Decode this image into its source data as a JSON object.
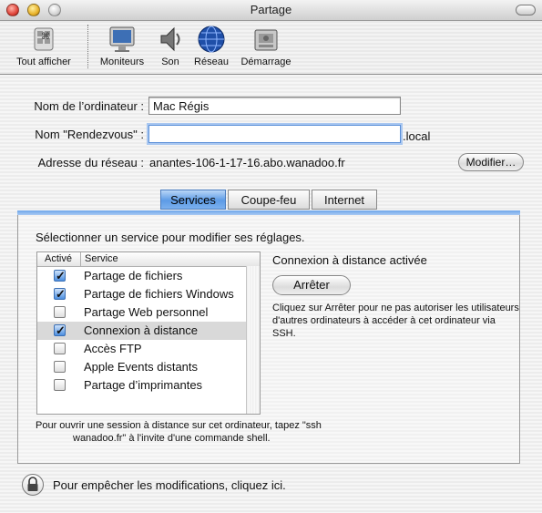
{
  "window": {
    "title": "Partage"
  },
  "toolbar": {
    "items": [
      {
        "label": "Tout afficher",
        "icon": "show-all-icon"
      },
      {
        "label": "Moniteurs",
        "icon": "monitor-icon"
      },
      {
        "label": "Son",
        "icon": "speaker-icon"
      },
      {
        "label": "Réseau",
        "icon": "network-globe-icon"
      },
      {
        "label": "Démarrage",
        "icon": "startup-disk-icon"
      }
    ]
  },
  "form": {
    "computer_name_label": "Nom de l’ordinateur :",
    "computer_name_value": "Mac Régis",
    "rendezvous_label": "Nom \"Rendezvous\" :",
    "rendezvous_value": "",
    "rendezvous_suffix": ".local",
    "address_label": "Adresse du réseau :",
    "address_value": "anantes-106-1-17-16.abo.wanadoo.fr",
    "modify_button": "Modifier…"
  },
  "tabs": [
    {
      "label": "Services",
      "active": true
    },
    {
      "label": "Coupe-feu",
      "active": false
    },
    {
      "label": "Internet",
      "active": false
    }
  ],
  "services": {
    "instruction": "Sélectionner un service pour modifier ses réglages.",
    "columns": {
      "active": "Activé",
      "service": "Service"
    },
    "rows": [
      {
        "name": "Partage de fichiers",
        "checked": true
      },
      {
        "name": "Partage de fichiers Windows",
        "checked": true
      },
      {
        "name": "Partage Web personnel",
        "checked": false
      },
      {
        "name": "Connexion à distance",
        "checked": true,
        "selected": true
      },
      {
        "name": "Accès FTP",
        "checked": false
      },
      {
        "name": "Apple Events distants",
        "checked": false
      },
      {
        "name": "Partage d’imprimantes",
        "checked": false
      }
    ],
    "status": "Connexion à distance activée",
    "stop_button": "Arrêter",
    "description": "Cliquez sur Arrêter pour ne pas autoriser les utilisateurs d'autres ordinateurs à accéder à cet ordinateur via SSH.",
    "footer_line1": "Pour ouvrir une session à distance sur cet ordinateur, tapez \"ssh",
    "footer_line2": "wanadoo.fr\" à l'invite d'une commande shell."
  },
  "lock": {
    "text": "Pour empêcher les modifications, cliquez ici."
  }
}
